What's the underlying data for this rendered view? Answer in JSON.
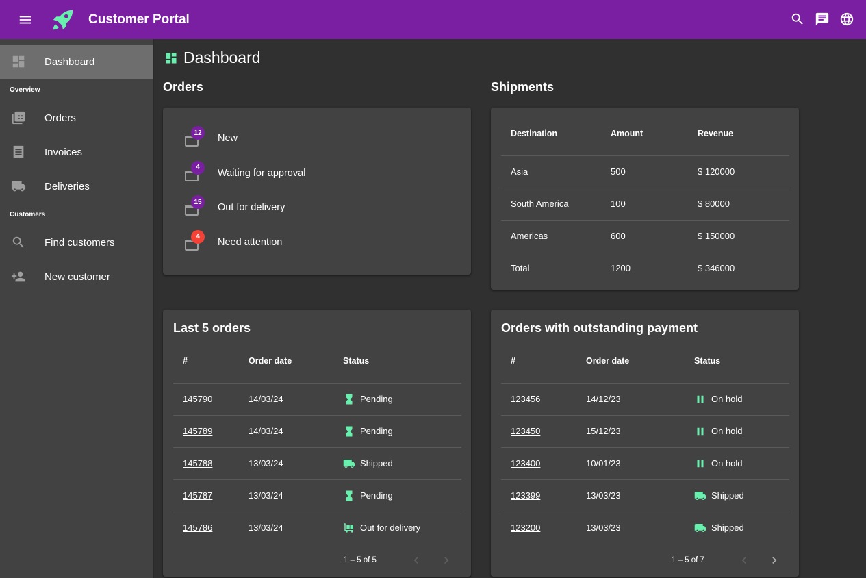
{
  "app": {
    "title": "Customer Portal",
    "accent_color": "#7b1fa2",
    "icon_color": "#69f0ae",
    "warn_color": "#f44336"
  },
  "topbar": {
    "menu_icon": "menu-icon",
    "logo_icon": "rocket-icon",
    "actions": [
      {
        "icon": "search-icon"
      },
      {
        "icon": "chat-icon"
      },
      {
        "icon": "language-globe-icon"
      }
    ]
  },
  "sidebar": {
    "active": {
      "label": "Dashboard",
      "icon": "dashboard-icon"
    },
    "groups": [
      {
        "label": "Overview",
        "items": [
          {
            "label": "Orders",
            "icon": "orders-icon"
          },
          {
            "label": "Invoices",
            "icon": "receipt-icon"
          },
          {
            "label": "Deliveries",
            "icon": "truck-icon"
          }
        ]
      },
      {
        "label": "Customers",
        "items": [
          {
            "label": "Find customers",
            "icon": "search-icon"
          },
          {
            "label": "New customer",
            "icon": "person-add-icon"
          }
        ]
      }
    ]
  },
  "page": {
    "title": "Dashboard",
    "icon": "dashboard-icon"
  },
  "orders": {
    "title": "Orders",
    "items": [
      {
        "label": "New",
        "count": "12",
        "badge": "primary"
      },
      {
        "label": "Waiting for approval",
        "count": "4",
        "badge": "primary"
      },
      {
        "label": "Out for delivery",
        "count": "15",
        "badge": "primary"
      },
      {
        "label": "Need attention",
        "count": "4",
        "badge": "warn"
      }
    ]
  },
  "shipments": {
    "title": "Shipments",
    "columns": [
      "Destination",
      "Amount",
      "Revenue"
    ],
    "rows": [
      [
        "Asia",
        "500",
        "$ 120000"
      ],
      [
        "South America",
        "100",
        "$ 80000"
      ],
      [
        "Americas",
        "600",
        "$ 150000"
      ],
      [
        "Total",
        "1200",
        "$ 346000"
      ]
    ]
  },
  "last_orders": {
    "title": "Last 5 orders",
    "columns": [
      "#",
      "Order date",
      "Status"
    ],
    "rows": [
      {
        "id": "145790",
        "date": "14/03/24",
        "status": "Pending",
        "icon": "hourglass-icon"
      },
      {
        "id": "145789",
        "date": "14/03/24",
        "status": "Pending",
        "icon": "hourglass-icon"
      },
      {
        "id": "145788",
        "date": "13/03/24",
        "status": "Shipped",
        "icon": "truck-icon"
      },
      {
        "id": "145787",
        "date": "13/03/24",
        "status": "Pending",
        "icon": "hourglass-icon"
      },
      {
        "id": "145786",
        "date": "13/03/24",
        "status": "Out for delivery",
        "icon": "trolley-icon"
      }
    ],
    "range": "1 – 5 of 5"
  },
  "outstanding": {
    "title": "Orders with outstanding payment",
    "columns": [
      "#",
      "Order date",
      "Status"
    ],
    "rows": [
      {
        "id": "123456",
        "date": "14/12/23",
        "status": "On hold",
        "icon": "pause-icon"
      },
      {
        "id": "123450",
        "date": "15/12/23",
        "status": "On hold",
        "icon": "pause-icon"
      },
      {
        "id": "123400",
        "date": "10/01/23",
        "status": "On hold",
        "icon": "pause-icon"
      },
      {
        "id": "123399",
        "date": "13/03/23",
        "status": "Shipped",
        "icon": "truck-icon"
      },
      {
        "id": "123200",
        "date": "13/03/23",
        "status": "Shipped",
        "icon": "truck-icon"
      }
    ],
    "range": "1 – 5 of 7"
  }
}
